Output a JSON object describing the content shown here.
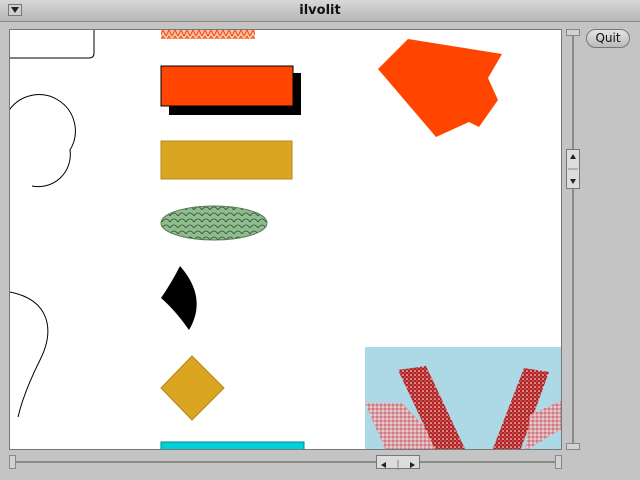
{
  "window": {
    "title": "ilvolit",
    "menu_icon": "window-menu-icon"
  },
  "toolbar": {
    "quit_label": "Quit"
  },
  "colors": {
    "orange": "#ff4500",
    "gold": "#daa520",
    "cyan": "#00d0d8",
    "lightblue": "#add8e6",
    "darkred": "#b22222",
    "black": "#000000",
    "fishscale": "#8fbc8f"
  },
  "shapes": [
    "stroked-curves",
    "pattern-strip",
    "orange-rectangle-with-shadow",
    "gold-rectangle",
    "fishscale-ellipse",
    "black-lens",
    "gold-diamond",
    "cyan-bar",
    "orange-house-polygon",
    "textured-bitmap-panel"
  ]
}
